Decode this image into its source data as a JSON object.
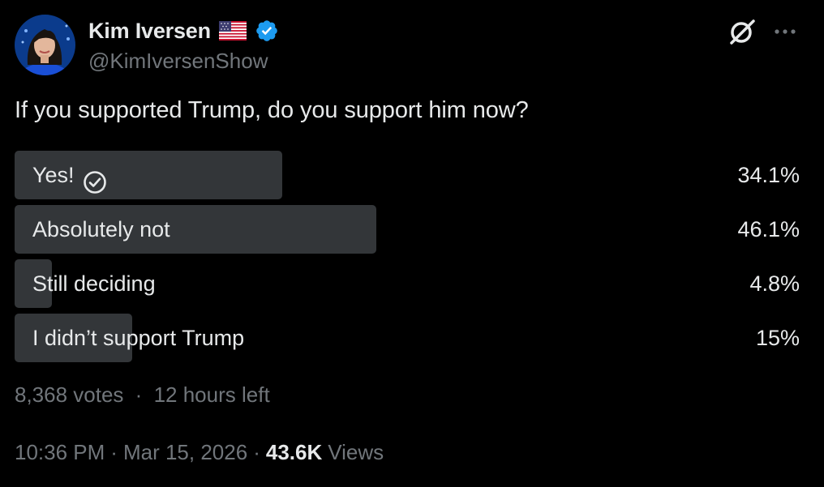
{
  "author": {
    "display_name": "Kim Iversen",
    "handle": "@KimIversenShow",
    "flag_icon": "us-flag-icon",
    "verified_icon": "verified-badge-icon",
    "verified_color": "#1d9bf0"
  },
  "header_actions": {
    "grok_icon": "grok-icon",
    "more_icon": "more-icon"
  },
  "tweet": {
    "text": "If you supported Trump, do you support him now?"
  },
  "poll": {
    "options": [
      {
        "label": "Yes!",
        "percent_text": "34.1%",
        "share": 0.341,
        "selected": true
      },
      {
        "label": "Absolutely not",
        "percent_text": "46.1%",
        "share": 0.461,
        "selected": false
      },
      {
        "label": "Still deciding",
        "percent_text": "4.8%",
        "share": 0.048,
        "selected": false
      },
      {
        "label": "I didn’t support Trump",
        "percent_text": "15%",
        "share": 0.15,
        "selected": false
      }
    ],
    "votes": "8,368 votes",
    "separator": "·",
    "time_left": "12 hours left"
  },
  "meta": {
    "time": "10:36 PM",
    "separator": "·",
    "date": "Mar 15, 2026",
    "views_count": "43.6K",
    "views_label": "Views"
  },
  "colors": {
    "background": "#000000",
    "text_primary": "#e7e9ea",
    "text_secondary": "#71767b",
    "poll_bar": "#333639"
  }
}
